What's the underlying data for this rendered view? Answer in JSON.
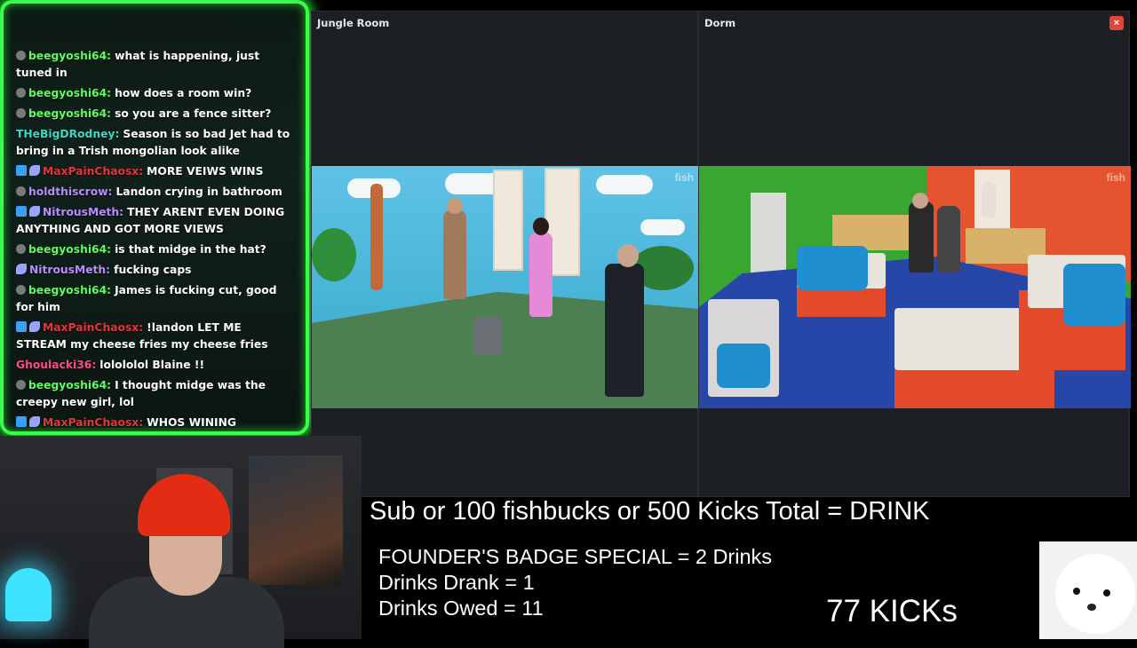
{
  "chat": {
    "messages": [
      {
        "badges": [
          "koala"
        ],
        "user": "beegyoshi64:",
        "user_color": "#5cff5c",
        "text": "what is happening, just tuned in"
      },
      {
        "badges": [
          "koala"
        ],
        "user": "beegyoshi64:",
        "user_color": "#5cff5c",
        "text": "how does a room win?"
      },
      {
        "badges": [
          "koala"
        ],
        "user": "beegyoshi64:",
        "user_color": "#5cff5c",
        "text": "so you are a fence sitter?"
      },
      {
        "badges": [],
        "user": "THeBigDRodney:",
        "user_color": "#3fd7c7",
        "text": "Season is so bad Jet had to bring in a Trish mongolian look alike"
      },
      {
        "badges": [
          "sub",
          "fish"
        ],
        "user": "MaxPainChaosx:",
        "user_color": "#e8333a",
        "text": "MORE VEIWS WINS"
      },
      {
        "badges": [
          "koala"
        ],
        "user": "holdthiscrow:",
        "user_color": "#b98cff",
        "text": "Landon crying in bathroom"
      },
      {
        "badges": [
          "sub",
          "fish"
        ],
        "user": "NitrousMeth:",
        "user_color": "#b98cff",
        "text": "THEY ARENT EVEN DOING ANYTHING AND GOT MORE VIEWS"
      },
      {
        "badges": [
          "koala"
        ],
        "user": "beegyoshi64:",
        "user_color": "#5cff5c",
        "text": "is that midge in the hat?"
      },
      {
        "badges": [
          "fish"
        ],
        "user": "NitrousMeth:",
        "user_color": "#b98cff",
        "text": "fucking caps"
      },
      {
        "badges": [
          "koala"
        ],
        "user": "beegyoshi64:",
        "user_color": "#5cff5c",
        "text": "James is fucking cut, good for him"
      },
      {
        "badges": [
          "sub",
          "fish"
        ],
        "user": "MaxPainChaosx:",
        "user_color": "#e8333a",
        "text": "!landon LET ME STREAM my cheese fries my cheese fries"
      },
      {
        "badges": [],
        "user": "Ghoulacki36:",
        "user_color": "#ff4b8b",
        "text": "lolololol Blaine !!"
      },
      {
        "badges": [
          "koala"
        ],
        "user": "beegyoshi64:",
        "user_color": "#5cff5c",
        "text": "I thought midge was the creepy new girl, lol"
      },
      {
        "badges": [
          "sub",
          "fish"
        ],
        "user": "MaxPainChaosx:",
        "user_color": "#e8333a",
        "text": "WHOS WINING"
      }
    ]
  },
  "cams": {
    "left_title": "Jungle Room",
    "right_title": "Dorm",
    "close_glyph": "×",
    "watermark": "fish"
  },
  "overlay": {
    "headline": "Sub or 100 fishbucks or 500 Kicks Total = DRINK",
    "founder": "FOUNDER'S BADGE SPECIAL = 2 Drinks",
    "drank": "Drinks Drank = 1",
    "owed": "Drinks Owed = 11",
    "kicks": "77 KICKs"
  },
  "colors": {
    "chat_border": "#39ff4a",
    "close_button": "#e0473a"
  }
}
